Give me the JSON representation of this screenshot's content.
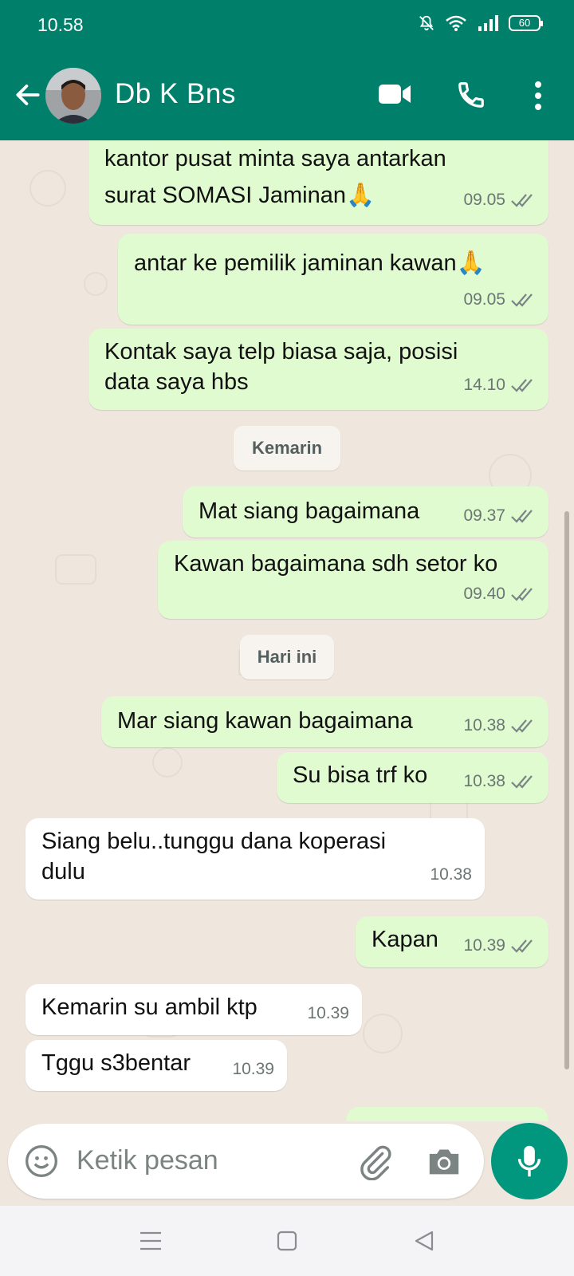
{
  "status_bar": {
    "time": "10.58",
    "battery": "60"
  },
  "header": {
    "contact_name": "Db K Bns"
  },
  "date_chips": [
    "Kemarin",
    "Hari ini"
  ],
  "messages": [
    {
      "direction": "out",
      "text": "kantor pusat minta saya antarkan\nsurat SOMASI Jaminan🙏",
      "time": "09.05",
      "status": "read"
    },
    {
      "direction": "out",
      "text": "antar ke pemilik jaminan kawan🙏",
      "time": "09.05",
      "status": "read"
    },
    {
      "direction": "out",
      "text": "Kontak saya telp biasa saja, posisi\ndata saya hbs",
      "time": "14.10",
      "status": "read"
    },
    {
      "direction": "out",
      "text": "Mat siang bagaimana",
      "time": "09.37",
      "status": "read"
    },
    {
      "direction": "out",
      "text": "Kawan bagaimana sdh setor ko",
      "time": "09.40",
      "status": "read"
    },
    {
      "direction": "out",
      "text": "Mar siang kawan bagaimana",
      "time": "10.38",
      "status": "read"
    },
    {
      "direction": "out",
      "text": "Su bisa trf ko",
      "time": "10.38",
      "status": "read"
    },
    {
      "direction": "in",
      "text": "Siang belu..tunggu dana koperasi\ndulu",
      "time": "10.38"
    },
    {
      "direction": "out",
      "text": "Kapan",
      "time": "10.39",
      "status": "read"
    },
    {
      "direction": "in",
      "text": "Kemarin su ambil ktp",
      "time": "10.39"
    },
    {
      "direction": "in",
      "text": "Tggu s3bentar",
      "time": "10.39"
    }
  ],
  "composer": {
    "placeholder": "Ketik pesan"
  },
  "colors": {
    "header": "#00806a",
    "outgoing_bubble": "#e0fbd0",
    "incoming_bubble": "#ffffff",
    "chat_bg": "#efe7dd",
    "read_tick": "#6b7574",
    "mic_button": "#00977e"
  },
  "icons": [
    "back-arrow-icon",
    "video-call-icon",
    "phone-icon",
    "more-vert-icon",
    "emoji-icon",
    "attach-icon",
    "camera-icon",
    "mic-icon",
    "mute-icon",
    "wifi-icon",
    "signal-icon",
    "battery-icon",
    "menu-nav-icon",
    "home-nav-icon",
    "back-nav-icon"
  ]
}
